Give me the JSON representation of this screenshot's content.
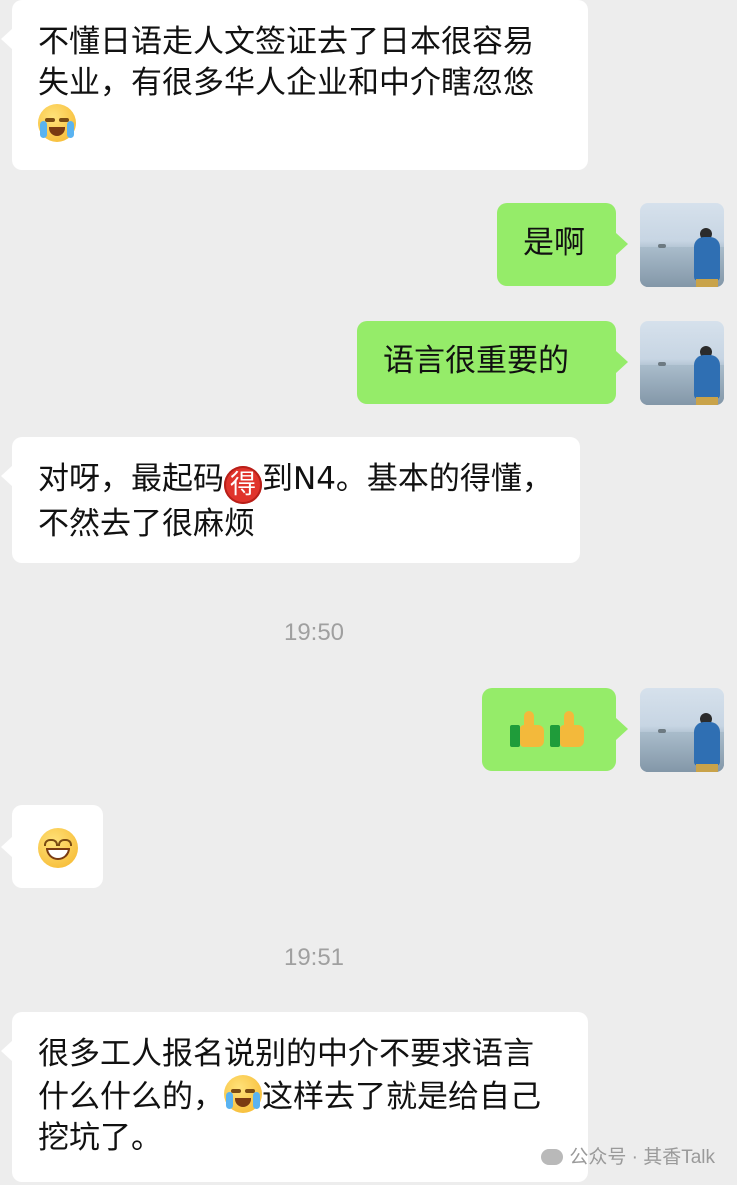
{
  "messages": [
    {
      "side": "in",
      "text_parts": [
        "不懂日语走人文签证去了日本很容易失业，有很多华人企业和中介瞎忽悠"
      ],
      "emoji_after": "loudly-crying-face"
    },
    {
      "side": "out",
      "text": "是啊"
    },
    {
      "side": "out",
      "text": "语言很重要的"
    },
    {
      "side": "in",
      "text_before": "对呀，最起码",
      "badge": "得",
      "text_after": "到N4。基本的得懂，不然去了很麻烦"
    },
    {
      "side": "out",
      "content": "thumbs-up thumbs-up"
    },
    {
      "side": "in",
      "content": "grinning-squinting-face"
    },
    {
      "side": "in",
      "text_before": "很多工人报名说别的中介不要求语言什么什么的，",
      "emoji": "loudly-crying-face",
      "text_after": "这样去了就是给自己挖坑了。"
    }
  ],
  "timestamps": [
    "19:50",
    "19:51"
  ],
  "watermark": "公众号 · 其香Talk",
  "colors": {
    "background": "#ededed",
    "incoming_bubble": "#ffffff",
    "outgoing_bubble": "#95ec69",
    "timestamp": "#a0a0a0",
    "badge": "#e0342c"
  },
  "icons": [
    "avatar-seaside-photo",
    "loudly-crying-face",
    "thumbs-up",
    "grinning-squinting-face",
    "wechat-icon"
  ]
}
